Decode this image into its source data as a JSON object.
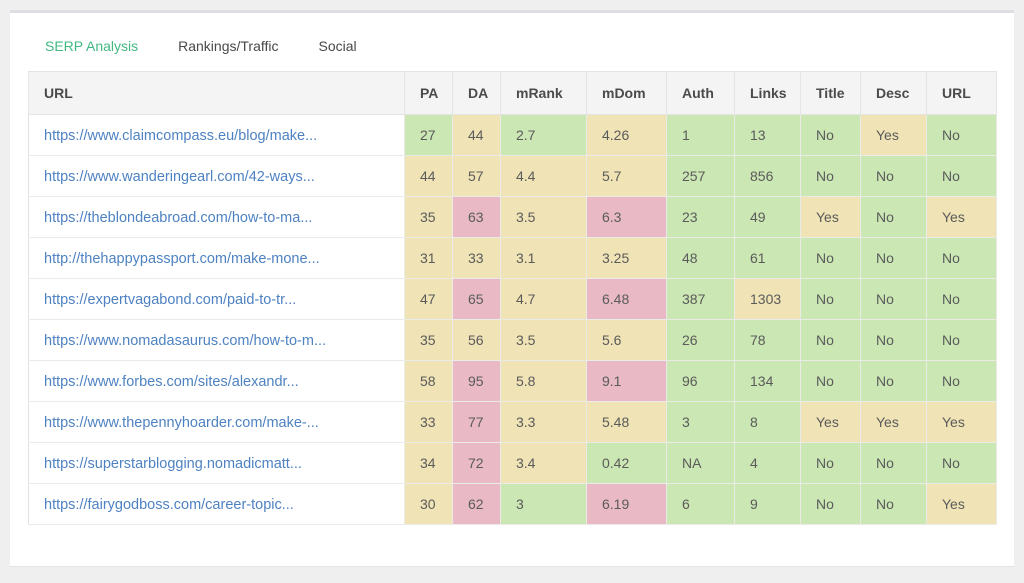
{
  "tabs": [
    {
      "label": "SERP Analysis",
      "active": true
    },
    {
      "label": "Rankings/Traffic",
      "active": false
    },
    {
      "label": "Social",
      "active": false
    }
  ],
  "colors": {
    "accent": "#42b983",
    "link": "#4e82c2",
    "green": "#cbe7b4",
    "tan": "#f0e3b5",
    "pink": "#e9bac6"
  },
  "table": {
    "columns": [
      "URL",
      "PA",
      "DA",
      "mRank",
      "mDom",
      "Auth",
      "Links",
      "Title",
      "Desc",
      "URL"
    ],
    "rows": [
      {
        "url": "https://www.claimcompass.eu/blog/make...",
        "cells": [
          {
            "v": "27",
            "c": "green"
          },
          {
            "v": "44",
            "c": "tan"
          },
          {
            "v": "2.7",
            "c": "green"
          },
          {
            "v": "4.26",
            "c": "tan"
          },
          {
            "v": "1",
            "c": "green"
          },
          {
            "v": "13",
            "c": "green"
          },
          {
            "v": "No",
            "c": "green"
          },
          {
            "v": "Yes",
            "c": "tan"
          },
          {
            "v": "No",
            "c": "green"
          }
        ]
      },
      {
        "url": "https://www.wanderingearl.com/42-ways...",
        "cells": [
          {
            "v": "44",
            "c": "tan"
          },
          {
            "v": "57",
            "c": "tan"
          },
          {
            "v": "4.4",
            "c": "tan"
          },
          {
            "v": "5.7",
            "c": "tan"
          },
          {
            "v": "257",
            "c": "green"
          },
          {
            "v": "856",
            "c": "green"
          },
          {
            "v": "No",
            "c": "green"
          },
          {
            "v": "No",
            "c": "green"
          },
          {
            "v": "No",
            "c": "green"
          }
        ]
      },
      {
        "url": "https://theblondeabroad.com/how-to-ma...",
        "cells": [
          {
            "v": "35",
            "c": "tan"
          },
          {
            "v": "63",
            "c": "pink"
          },
          {
            "v": "3.5",
            "c": "tan"
          },
          {
            "v": "6.3",
            "c": "pink"
          },
          {
            "v": "23",
            "c": "green"
          },
          {
            "v": "49",
            "c": "green"
          },
          {
            "v": "Yes",
            "c": "tan"
          },
          {
            "v": "No",
            "c": "green"
          },
          {
            "v": "Yes",
            "c": "tan"
          }
        ]
      },
      {
        "url": "http://thehappypassport.com/make-mone...",
        "cells": [
          {
            "v": "31",
            "c": "tan"
          },
          {
            "v": "33",
            "c": "tan"
          },
          {
            "v": "3.1",
            "c": "tan"
          },
          {
            "v": "3.25",
            "c": "tan"
          },
          {
            "v": "48",
            "c": "green"
          },
          {
            "v": "61",
            "c": "green"
          },
          {
            "v": "No",
            "c": "green"
          },
          {
            "v": "No",
            "c": "green"
          },
          {
            "v": "No",
            "c": "green"
          }
        ]
      },
      {
        "url": "https://expertvagabond.com/paid-to-tr...",
        "cells": [
          {
            "v": "47",
            "c": "tan"
          },
          {
            "v": "65",
            "c": "pink"
          },
          {
            "v": "4.7",
            "c": "tan"
          },
          {
            "v": "6.48",
            "c": "pink"
          },
          {
            "v": "387",
            "c": "green"
          },
          {
            "v": "1303",
            "c": "tan"
          },
          {
            "v": "No",
            "c": "green"
          },
          {
            "v": "No",
            "c": "green"
          },
          {
            "v": "No",
            "c": "green"
          }
        ]
      },
      {
        "url": "https://www.nomadasaurus.com/how-to-m...",
        "cells": [
          {
            "v": "35",
            "c": "tan"
          },
          {
            "v": "56",
            "c": "tan"
          },
          {
            "v": "3.5",
            "c": "tan"
          },
          {
            "v": "5.6",
            "c": "tan"
          },
          {
            "v": "26",
            "c": "green"
          },
          {
            "v": "78",
            "c": "green"
          },
          {
            "v": "No",
            "c": "green"
          },
          {
            "v": "No",
            "c": "green"
          },
          {
            "v": "No",
            "c": "green"
          }
        ]
      },
      {
        "url": "https://www.forbes.com/sites/alexandr...",
        "cells": [
          {
            "v": "58",
            "c": "tan"
          },
          {
            "v": "95",
            "c": "pink"
          },
          {
            "v": "5.8",
            "c": "tan"
          },
          {
            "v": "9.1",
            "c": "pink"
          },
          {
            "v": "96",
            "c": "green"
          },
          {
            "v": "134",
            "c": "green"
          },
          {
            "v": "No",
            "c": "green"
          },
          {
            "v": "No",
            "c": "green"
          },
          {
            "v": "No",
            "c": "green"
          }
        ]
      },
      {
        "url": "https://www.thepennyhoarder.com/make-...",
        "cells": [
          {
            "v": "33",
            "c": "tan"
          },
          {
            "v": "77",
            "c": "pink"
          },
          {
            "v": "3.3",
            "c": "tan"
          },
          {
            "v": "5.48",
            "c": "tan"
          },
          {
            "v": "3",
            "c": "green"
          },
          {
            "v": "8",
            "c": "green"
          },
          {
            "v": "Yes",
            "c": "tan"
          },
          {
            "v": "Yes",
            "c": "tan"
          },
          {
            "v": "Yes",
            "c": "tan"
          }
        ]
      },
      {
        "url": "https://superstarblogging.nomadicmatt...",
        "cells": [
          {
            "v": "34",
            "c": "tan"
          },
          {
            "v": "72",
            "c": "pink"
          },
          {
            "v": "3.4",
            "c": "tan"
          },
          {
            "v": "0.42",
            "c": "green"
          },
          {
            "v": "NA",
            "c": "green"
          },
          {
            "v": "4",
            "c": "green"
          },
          {
            "v": "No",
            "c": "green"
          },
          {
            "v": "No",
            "c": "green"
          },
          {
            "v": "No",
            "c": "green"
          }
        ]
      },
      {
        "url": "https://fairygodboss.com/career-topic...",
        "cells": [
          {
            "v": "30",
            "c": "tan"
          },
          {
            "v": "62",
            "c": "pink"
          },
          {
            "v": "3",
            "c": "green"
          },
          {
            "v": "6.19",
            "c": "pink"
          },
          {
            "v": "6",
            "c": "green"
          },
          {
            "v": "9",
            "c": "green"
          },
          {
            "v": "No",
            "c": "green"
          },
          {
            "v": "No",
            "c": "green"
          },
          {
            "v": "Yes",
            "c": "tan"
          }
        ]
      }
    ]
  }
}
